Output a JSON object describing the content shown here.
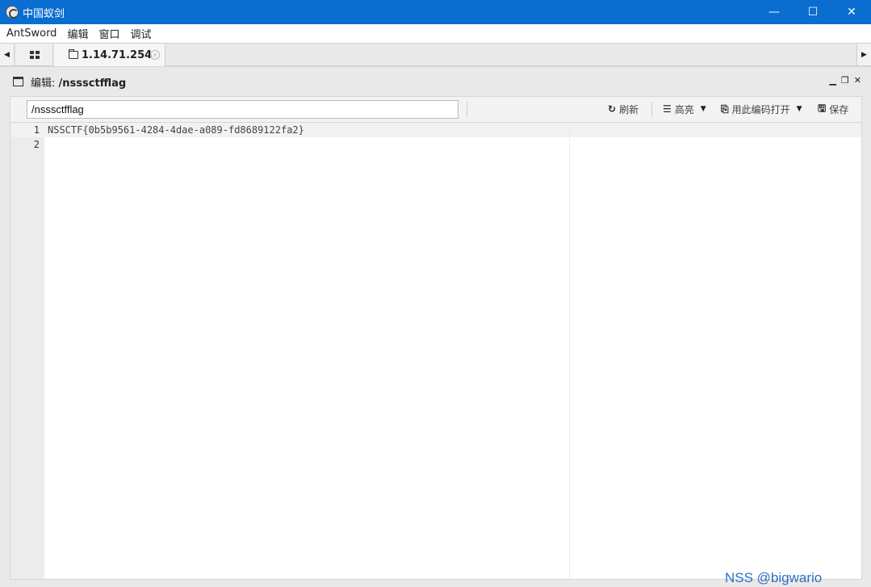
{
  "window": {
    "title": "中国蚁剑",
    "controls": {
      "minimize": "—",
      "maximize": "☐",
      "close": "✕"
    }
  },
  "menubar": {
    "items": [
      "AntSword",
      "编辑",
      "窗口",
      "调试"
    ]
  },
  "tabs": {
    "scroll_left": "◀",
    "scroll_right": "▶",
    "home_icon": "grid-icon",
    "active_tab_label": "1.14.71.254",
    "active_tab_close": "✕"
  },
  "editor_panel": {
    "title_prefix": "编辑: ",
    "title_path": "/nsssctfflag",
    "controls": {
      "minimize": "▁",
      "restore": "❐",
      "close": "✕"
    },
    "toolbar": {
      "path_value": "/nsssctfflag",
      "refresh_icon": "↻",
      "refresh_label": "刷新",
      "highlight_icon": "☰",
      "highlight_label": "高亮",
      "encoding_icon": "⎘",
      "encoding_label": "用此编码打开",
      "save_icon": "🖫",
      "save_label": "保存",
      "caret": "▼"
    },
    "lines": [
      {
        "number": "1",
        "text": "NSSCTF{0b5b9561-4284-4dae-a089-fd8689122fa2}"
      },
      {
        "number": "2",
        "text": ""
      }
    ]
  },
  "watermark": "NSS @bigwario"
}
